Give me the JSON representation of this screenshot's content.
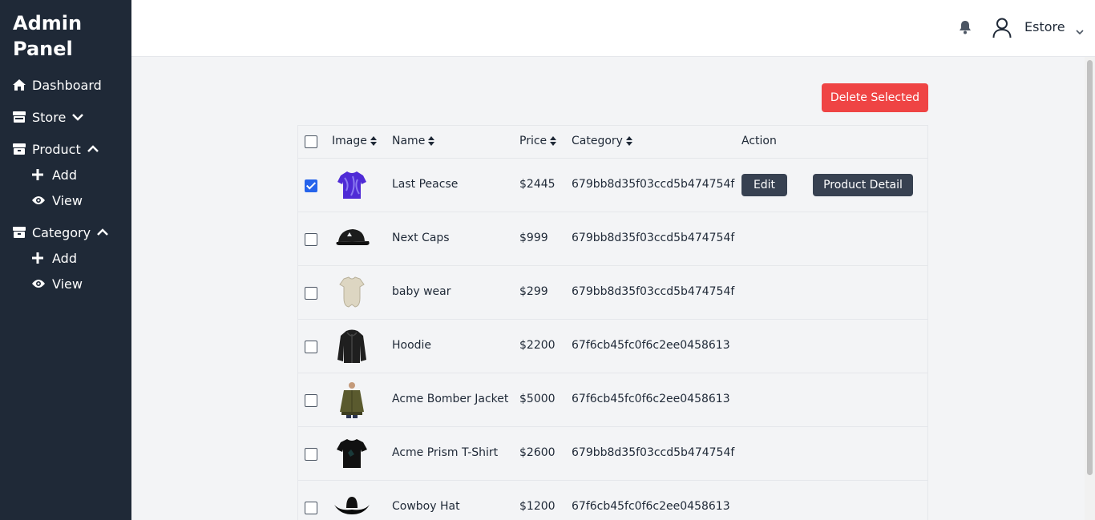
{
  "sidebar": {
    "brand": "Admin Panel",
    "items": [
      {
        "label": "Dashboard",
        "icon": "home-icon"
      },
      {
        "label": "Store",
        "icon": "store-icon"
      },
      {
        "label": "Product",
        "icon": "box-icon"
      },
      {
        "label": "Category",
        "icon": "box-icon"
      }
    ],
    "product_sub": [
      {
        "label": "Add",
        "icon": "plus-icon"
      },
      {
        "label": "View",
        "icon": "eye-icon"
      }
    ],
    "category_sub": [
      {
        "label": "Add",
        "icon": "plus-icon"
      },
      {
        "label": "View",
        "icon": "eye-icon"
      }
    ]
  },
  "header": {
    "user_name": "Estore"
  },
  "toolbar": {
    "delete_label": "Delete Selected"
  },
  "table": {
    "headers": {
      "image": "Image",
      "name": "Name",
      "price": "Price",
      "category": "Category",
      "action": "Action"
    },
    "edit_label": "Edit",
    "detail_label": "Product Detail",
    "rows": [
      {
        "name": "Last Peacse",
        "price": "$2445",
        "category": "679bb8d35f03ccd5b474754f",
        "checked": true,
        "thumb": "tshirt-purple"
      },
      {
        "name": "Next Caps",
        "price": "$999",
        "category": "679bb8d35f03ccd5b474754f",
        "checked": false,
        "thumb": "cap-black"
      },
      {
        "name": "baby wear",
        "price": "$299",
        "category": "679bb8d35f03ccd5b474754f",
        "checked": false,
        "thumb": "onesie-beige"
      },
      {
        "name": "Hoodie",
        "price": "$2200",
        "category": "67f6cb45fc0f6c2ee0458613",
        "checked": false,
        "thumb": "hoodie-black"
      },
      {
        "name": "Acme Bomber Jacket",
        "price": "$5000",
        "category": "67f6cb45fc0f6c2ee0458613",
        "checked": false,
        "thumb": "jacket-olive"
      },
      {
        "name": "Acme Prism T-Shirt",
        "price": "$2600",
        "category": "679bb8d35f03ccd5b474754f",
        "checked": false,
        "thumb": "tshirt-black"
      },
      {
        "name": "Cowboy Hat",
        "price": "$1200",
        "category": "67f6cb45fc0f6c2ee0458613",
        "checked": false,
        "thumb": "hat-black"
      }
    ]
  },
  "colors": {
    "sidebar_bg": "#1f2937",
    "danger": "#ef4444",
    "dark_button": "#374151",
    "checkbox_checked": "#2563eb"
  }
}
